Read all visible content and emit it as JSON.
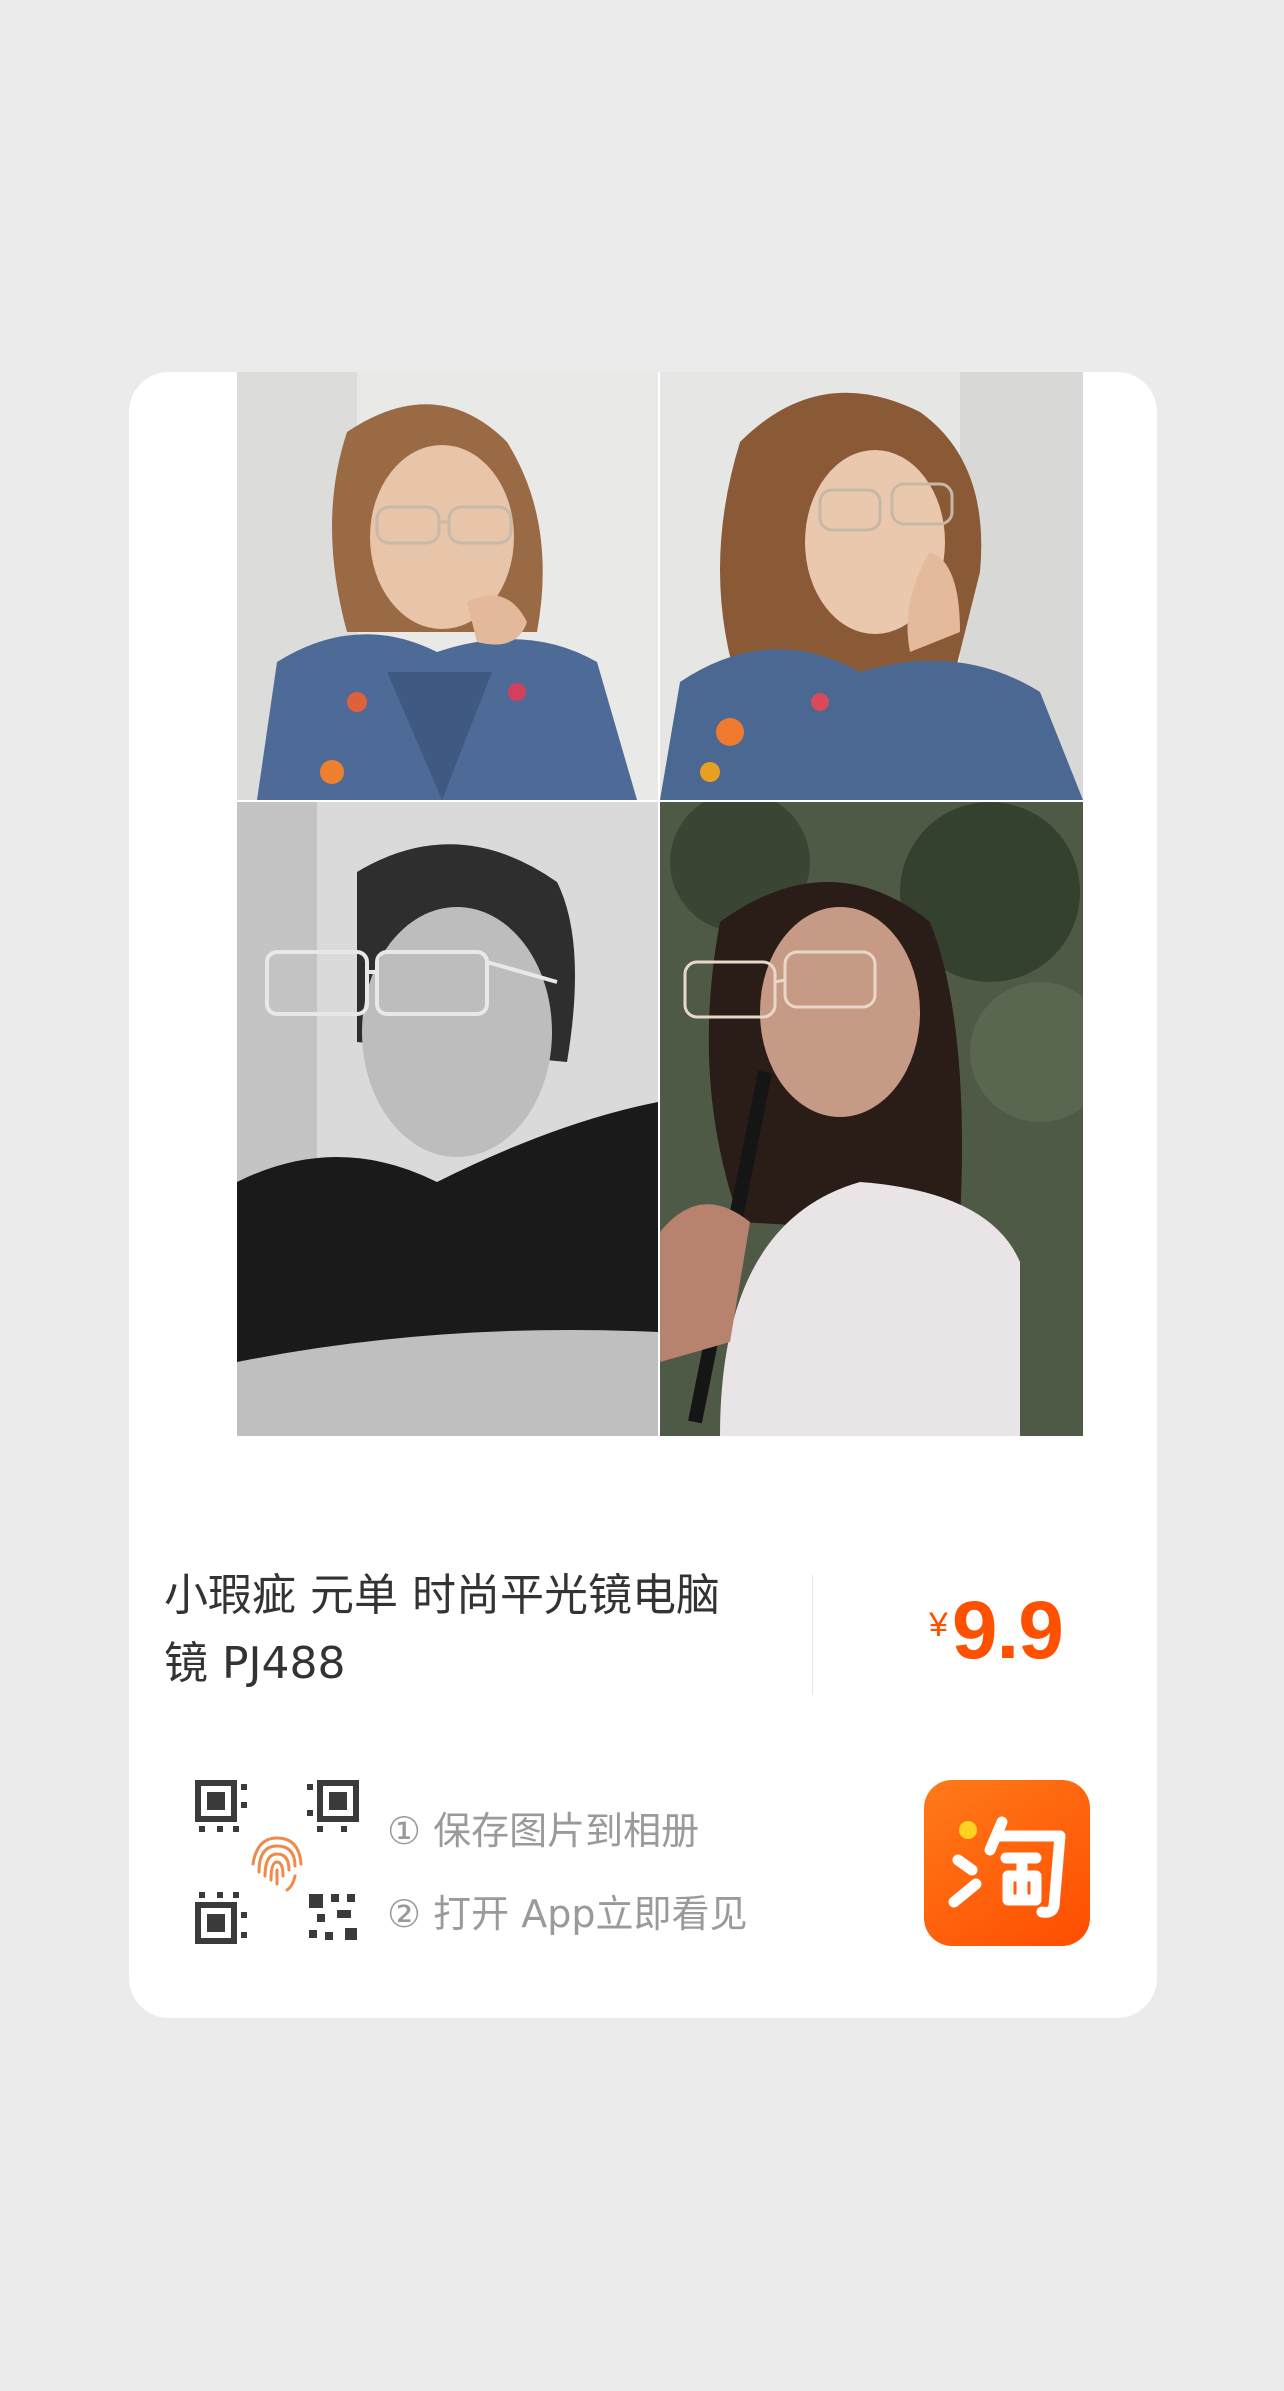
{
  "product": {
    "title": "小瑕疵 元单 时尚平光镜电脑镜 PJ488",
    "price_currency": "¥",
    "price_value": "9.9"
  },
  "instructions": {
    "step1": "① 保存图片到相册",
    "step2": "② 打开 App立即看见"
  },
  "photos": [
    {
      "name": "photo-woman-denim-jacket-glasses-front"
    },
    {
      "name": "photo-woman-denim-jacket-glasses-side"
    },
    {
      "name": "photo-woman-black-white-glasses"
    },
    {
      "name": "photo-woman-white-top-glasses"
    }
  ],
  "icons": {
    "qr": "qr-code-icon",
    "fingerprint": "fingerprint-icon",
    "app": "taobao-app-icon"
  },
  "colors": {
    "accent": "#ff5000",
    "background": "#ebebeb",
    "card": "#ffffff",
    "title_text": "#333333",
    "instruction_text": "#9a9a9a"
  }
}
